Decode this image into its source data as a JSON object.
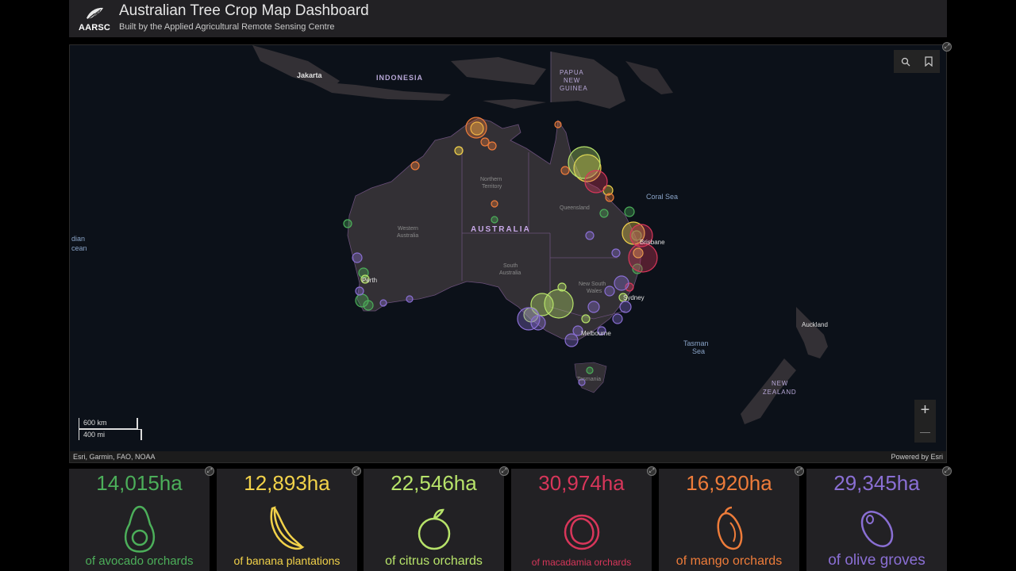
{
  "header": {
    "logo_text": "AARSC",
    "title": "Australian Tree Crop Map Dashboard",
    "subtitle": "Built by the Applied Agricultural Remote Sensing Centre"
  },
  "map": {
    "labels": {
      "jakarta": "Jakarta",
      "indonesia": "INDONESIA",
      "papua1": "PAPUA",
      "papua2": "NEW",
      "papua3": "GUINEA",
      "coral_sea": "Coral Sea",
      "tasman1": "Tasman",
      "tasman2": "Sea",
      "auckland": "Auckland",
      "nz1": "NEW",
      "nz2": "ZEALAND",
      "indian1": "dian",
      "indian2": "cean",
      "australia": "AUSTRALIA",
      "wa1": "Western",
      "wa2": "Australia",
      "nt1": "Northern",
      "nt2": "Territory",
      "qld": "Queensland",
      "sa1": "South",
      "sa2": "Australia",
      "nsw1": "New South",
      "nsw2": "Wales",
      "perth": "Perth",
      "brisbane": "Brisbane",
      "sydney": "Sydney",
      "melbourne": "Melbourne",
      "tasmania": "Tasmania"
    },
    "scale_km": "600 km",
    "scale_mi": "400 mi",
    "attribution_left": "Esri, Garmin, FAO, NOAA",
    "attribution_right": "Powered by Esri",
    "tools": {
      "search": "search-icon",
      "bookmark": "bookmark-icon"
    },
    "zoom_in": "+",
    "zoom_out": "—"
  },
  "stats": [
    {
      "value": "14,015ha",
      "label": "of avocado orchards",
      "color": "#4caf5a",
      "icon": "avocado-icon"
    },
    {
      "value": "12,893ha",
      "label": "of banana plantations",
      "color": "#f2d24a",
      "icon": "banana-icon"
    },
    {
      "value": "22,546ha",
      "label": "of citrus orchards",
      "color": "#b7e36a",
      "icon": "citrus-icon"
    },
    {
      "value": "30,974ha",
      "label": "of macadamia orchards",
      "color": "#d8365a",
      "icon": "macadamia-icon"
    },
    {
      "value": "16,920ha",
      "label": "of mango orchards",
      "color": "#ee7c3a",
      "icon": "mango-icon"
    },
    {
      "value": "29,345ha",
      "label": "of olive groves",
      "color": "#8a6fd4",
      "icon": "olive-icon"
    }
  ]
}
